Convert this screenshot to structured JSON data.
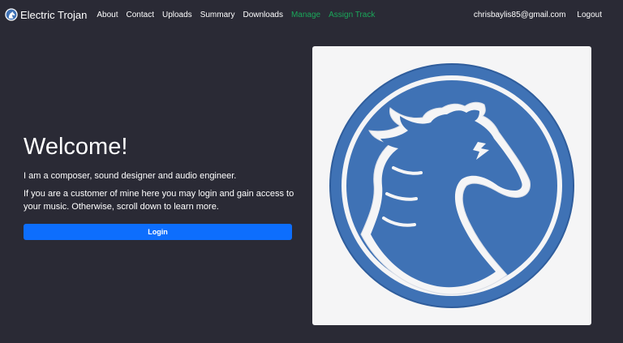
{
  "navbar": {
    "brand": {
      "name": "Electric Trojan",
      "icon": "trojan-horse-logo-icon"
    },
    "links": [
      {
        "label": "About"
      },
      {
        "label": "Contact"
      },
      {
        "label": "Uploads"
      },
      {
        "label": "Summary"
      },
      {
        "label": "Downloads"
      },
      {
        "label": "Manage"
      },
      {
        "label": "Assign Track"
      }
    ],
    "user_email": "chrisbaylis85@gmail.com",
    "logout_label": "Logout"
  },
  "hero": {
    "title": "Welcome!",
    "paragraph1": "I am a composer, sound designer and audio engineer.",
    "paragraph2": "If you are a customer of mine here you may login and gain access to your music. Otherwise, scroll down to learn more.",
    "login_label": "Login",
    "image_icon": "trojan-horse-logo-icon"
  },
  "colors": {
    "background": "#2a2a35",
    "accent": "#0d6efd",
    "logo_blue": "#3f72b5",
    "nav_green": "#1aa85a",
    "image_bg": "#f5f5f6"
  }
}
